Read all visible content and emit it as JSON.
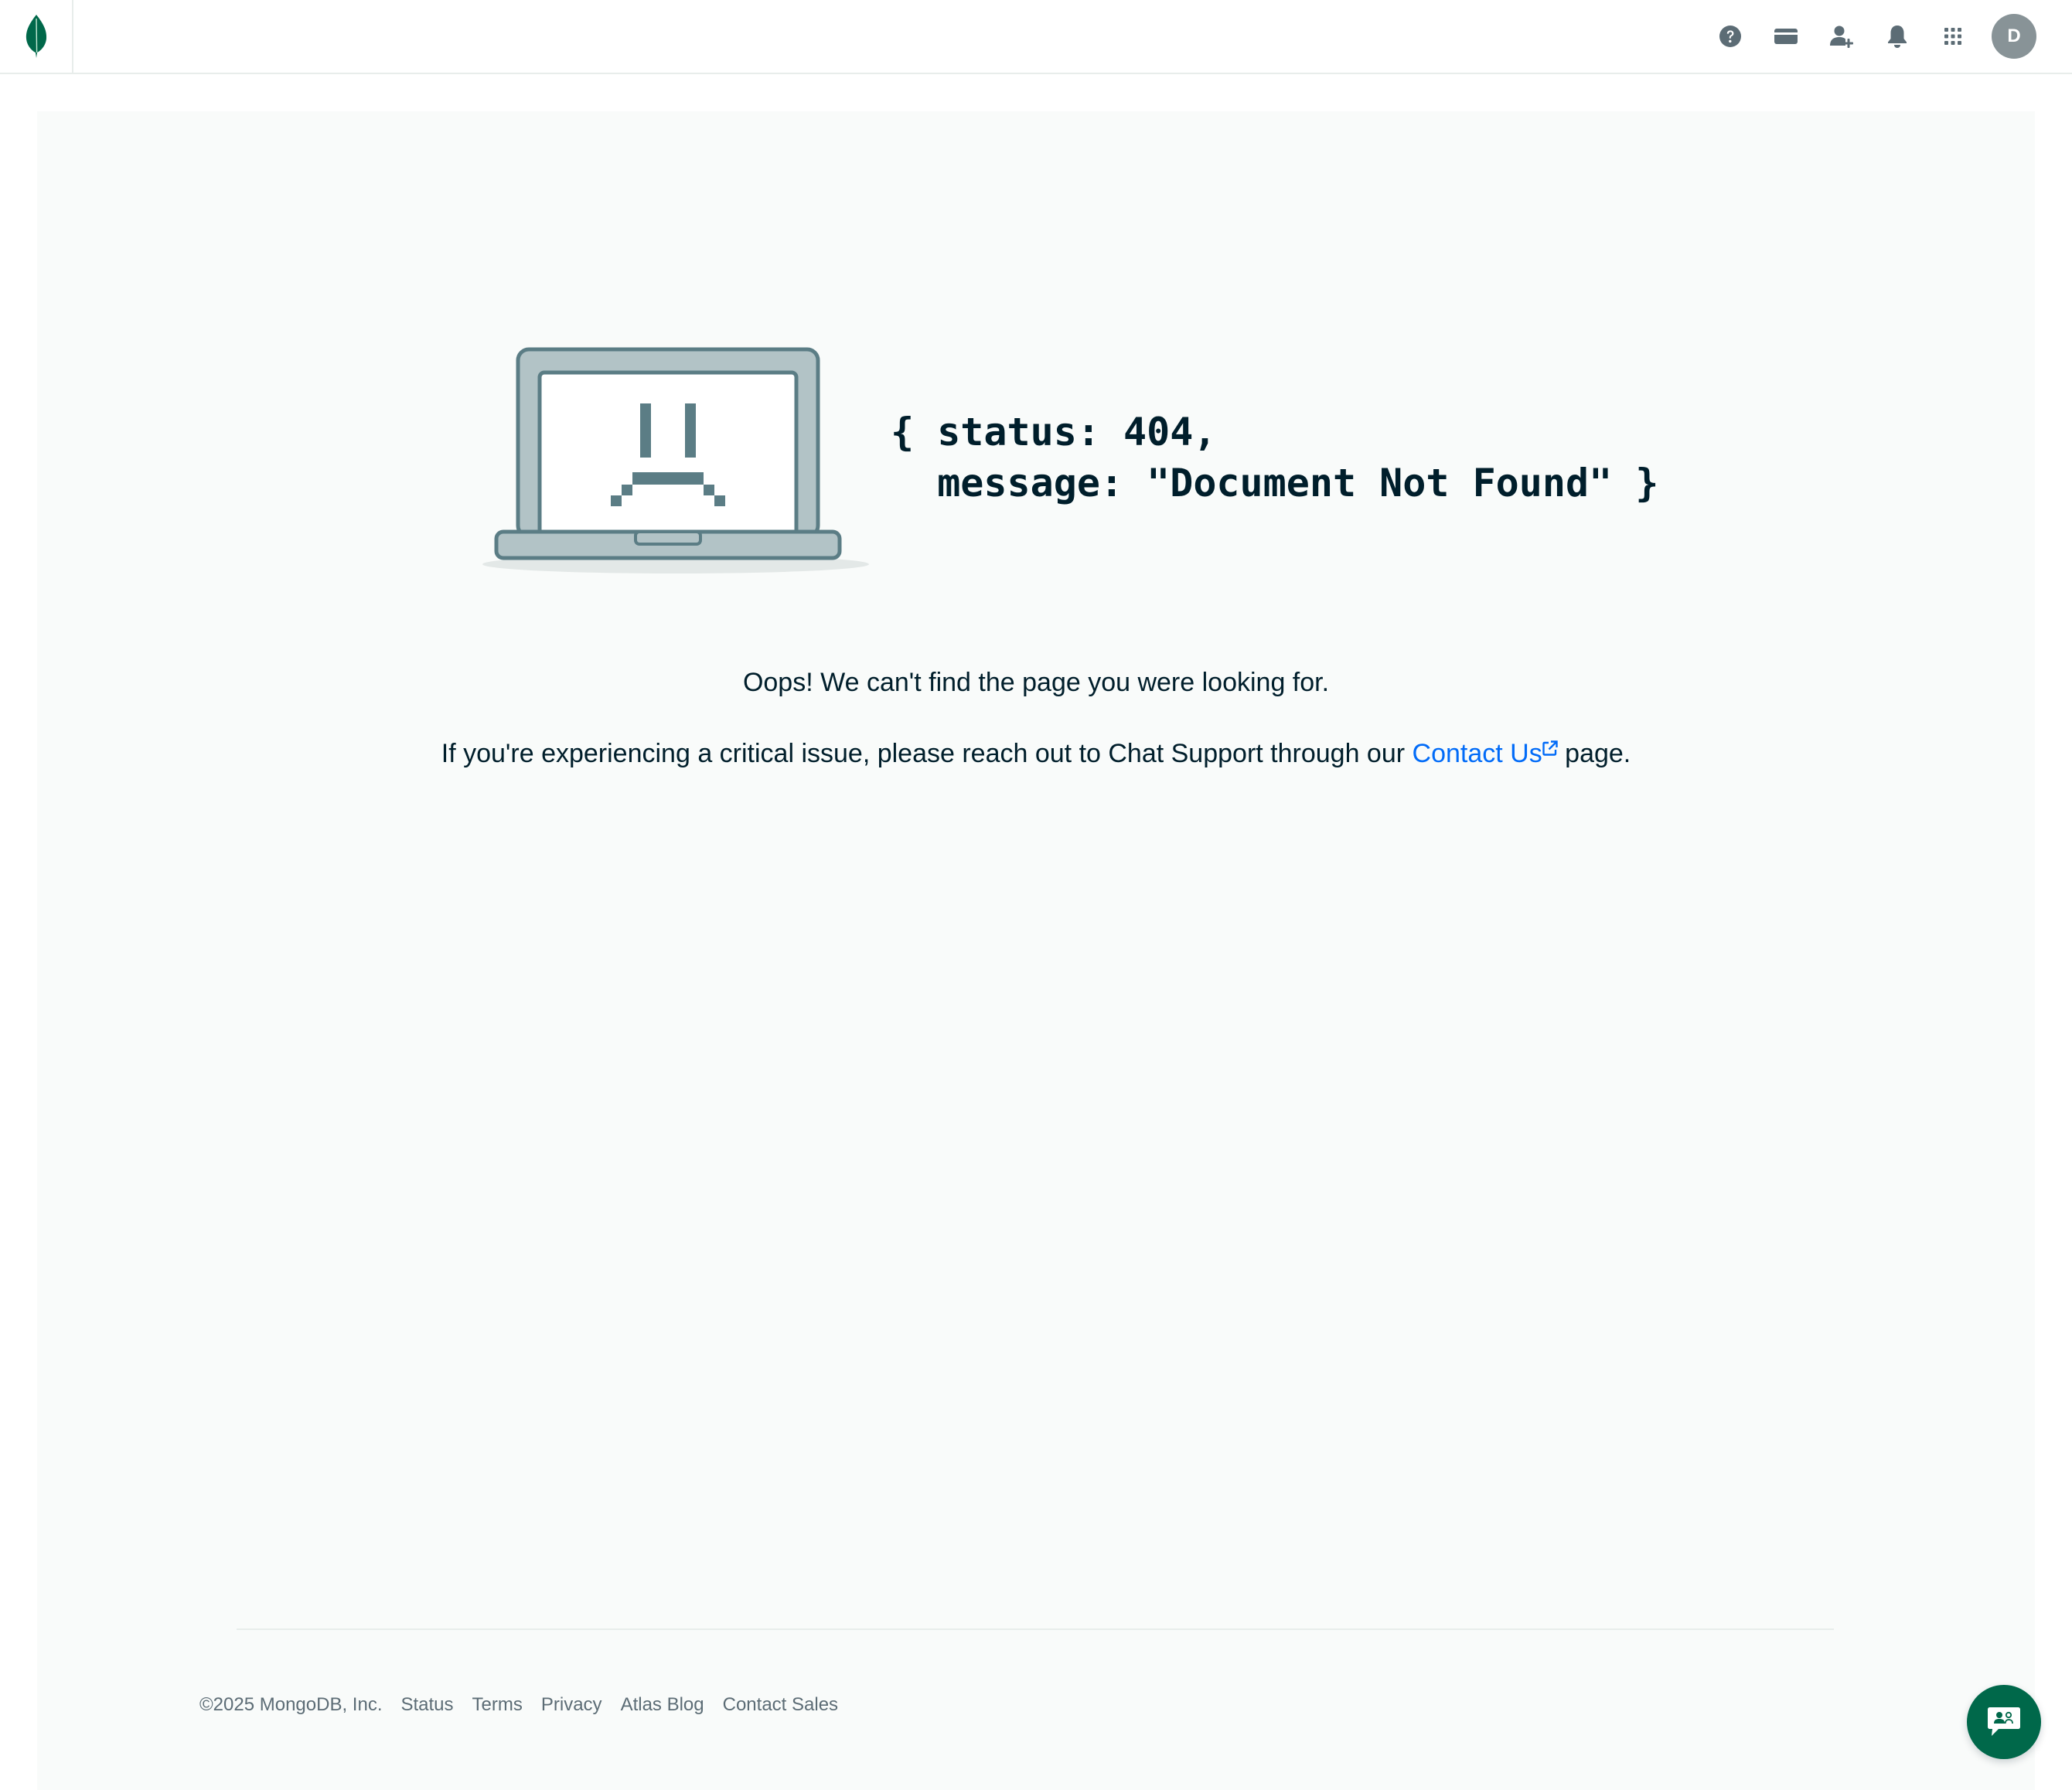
{
  "header": {
    "logo_icon": "mongodb-leaf-icon",
    "icons": [
      "help-icon",
      "billing-card-icon",
      "invite-user-icon",
      "notifications-bell-icon",
      "apps-grid-icon"
    ],
    "avatar_initial": "D"
  },
  "error": {
    "code_line_1": "{ status: 404,",
    "code_line_2": "  message: \"Document Not Found\" }",
    "message": "Oops! We can't find the page you were looking for.",
    "support_prefix": "If you're experiencing a critical issue, please reach out to Chat Support through our",
    "contact_link": "Contact Us",
    "support_suffix": "page."
  },
  "footer": {
    "copyright": "©2025 MongoDB, Inc.",
    "links": [
      "Status",
      "Terms",
      "Privacy",
      "Atlas Blog",
      "Contact Sales"
    ]
  },
  "colors": {
    "brand_green": "#00684a",
    "leaf_green": "#00684a",
    "link_blue": "#016bf8",
    "icon_gray": "#5c6c75",
    "panel_bg": "#f9fbfa"
  }
}
